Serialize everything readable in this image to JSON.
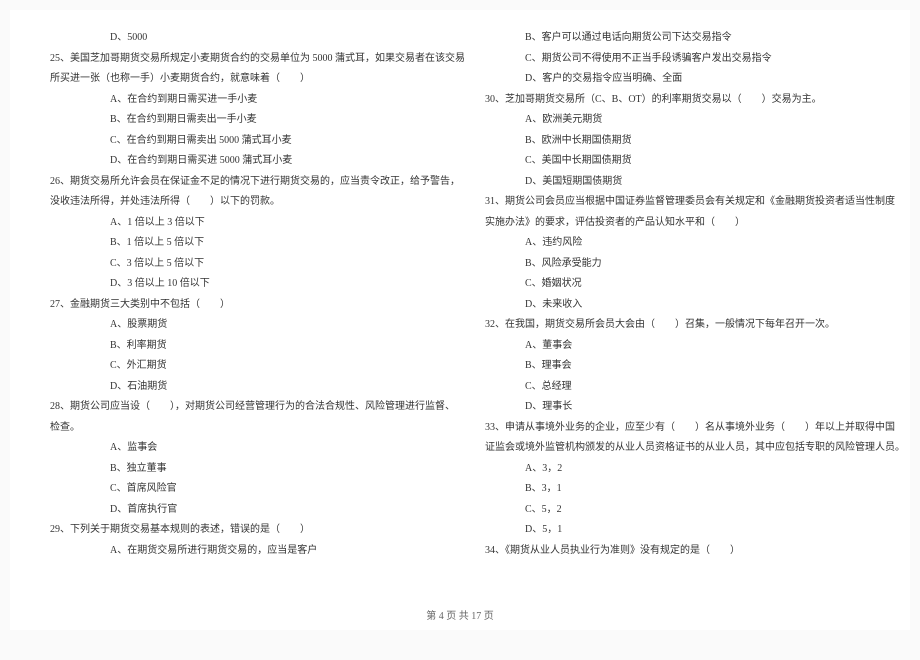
{
  "left": [
    {
      "t": "D、5000",
      "c": "indent"
    },
    {
      "t": "25、美国芝加哥期货交易所规定小麦期货合约的交易单位为 5000 蒲式耳，如果交易者在该交易",
      "c": "indent1"
    },
    {
      "t": "所买进一张（也称一手）小麦期货合约，就意味着（　　）",
      "c": "indent1"
    },
    {
      "t": "A、在合约到期日需买进一手小麦",
      "c": "indent"
    },
    {
      "t": "B、在合约到期日需卖出一手小麦",
      "c": "indent"
    },
    {
      "t": "C、在合约到期日需卖出 5000 蒲式耳小麦",
      "c": "indent"
    },
    {
      "t": "D、在合约到期日需买进 5000 蒲式耳小麦",
      "c": "indent"
    },
    {
      "t": "26、期货交易所允许会员在保证金不足的情况下进行期货交易的，应当责令改正，给予警告，",
      "c": "indent1"
    },
    {
      "t": "没收违法所得，并处违法所得（　　）以下的罚款。",
      "c": "indent1"
    },
    {
      "t": "A、1 倍以上 3 倍以下",
      "c": "indent"
    },
    {
      "t": "B、1 倍以上 5 倍以下",
      "c": "indent"
    },
    {
      "t": "C、3 倍以上 5 倍以下",
      "c": "indent"
    },
    {
      "t": "D、3 倍以上 10 倍以下",
      "c": "indent"
    },
    {
      "t": "27、金融期货三大类别中不包括（　　）",
      "c": "indent1"
    },
    {
      "t": "A、股票期货",
      "c": "indent"
    },
    {
      "t": "B、利率期货",
      "c": "indent"
    },
    {
      "t": "C、外汇期货",
      "c": "indent"
    },
    {
      "t": "D、石油期货",
      "c": "indent"
    },
    {
      "t": "28、期货公司应当设（　　），对期货公司经营管理行为的合法合规性、风险管理进行监督、",
      "c": "indent1"
    },
    {
      "t": "检查。",
      "c": "indent1"
    },
    {
      "t": "A、监事会",
      "c": "indent"
    },
    {
      "t": "B、独立董事",
      "c": "indent"
    },
    {
      "t": "C、首席风险官",
      "c": "indent"
    },
    {
      "t": "D、首席执行官",
      "c": "indent"
    },
    {
      "t": "29、下列关于期货交易基本规则的表述，错误的是（　　）",
      "c": "indent1"
    },
    {
      "t": "A、在期货交易所进行期货交易的，应当是客户",
      "c": "indent"
    }
  ],
  "right": [
    {
      "t": "B、客户可以通过电话向期货公司下达交易指令",
      "c": "indent2"
    },
    {
      "t": "C、期货公司不得使用不正当手段诱骗客户发出交易指令",
      "c": "indent2"
    },
    {
      "t": "D、客户的交易指令应当明确、全面",
      "c": "indent2"
    },
    {
      "t": "30、芝加哥期货交易所（C、B、OT）的利率期货交易以（　　）交易为主。",
      "c": "indent1"
    },
    {
      "t": "A、欧洲美元期货",
      "c": "indent2"
    },
    {
      "t": "B、欧洲中长期国债期货",
      "c": "indent2"
    },
    {
      "t": "C、美国中长期国债期货",
      "c": "indent2"
    },
    {
      "t": "D、美国短期国债期货",
      "c": "indent2"
    },
    {
      "t": "31、期货公司会员应当根据中国证券监督管理委员会有关规定和《金融期货投资者适当性制度",
      "c": "indent1"
    },
    {
      "t": "实施办法》的要求，评估投资者的产品认知水平和（　　）",
      "c": "indent1"
    },
    {
      "t": "A、违约风险",
      "c": "indent2"
    },
    {
      "t": "B、风险承受能力",
      "c": "indent2"
    },
    {
      "t": "C、婚姻状况",
      "c": "indent2"
    },
    {
      "t": "D、未来收入",
      "c": "indent2"
    },
    {
      "t": "32、在我国，期货交易所会员大会由（　　）召集，一般情况下每年召开一次。",
      "c": "indent1"
    },
    {
      "t": "A、董事会",
      "c": "indent2"
    },
    {
      "t": "B、理事会",
      "c": "indent2"
    },
    {
      "t": "C、总经理",
      "c": "indent2"
    },
    {
      "t": "D、理事长",
      "c": "indent2"
    },
    {
      "t": "33、申请从事境外业务的企业，应至少有（　　）名从事境外业务（　　）年以上并取得中国",
      "c": "indent1"
    },
    {
      "t": "证监会或境外监管机构颁发的从业人员资格证书的从业人员，其中应包括专职的风险管理人员。",
      "c": "indent1"
    },
    {
      "t": "A、3，2",
      "c": "indent2"
    },
    {
      "t": "B、3，1",
      "c": "indent2"
    },
    {
      "t": "C、5，2",
      "c": "indent2"
    },
    {
      "t": "D、5，1",
      "c": "indent2"
    },
    {
      "t": "34、《期货从业人员执业行为准则》没有规定的是（　　）",
      "c": "indent1"
    }
  ],
  "footer": "第 4 页 共 17 页"
}
